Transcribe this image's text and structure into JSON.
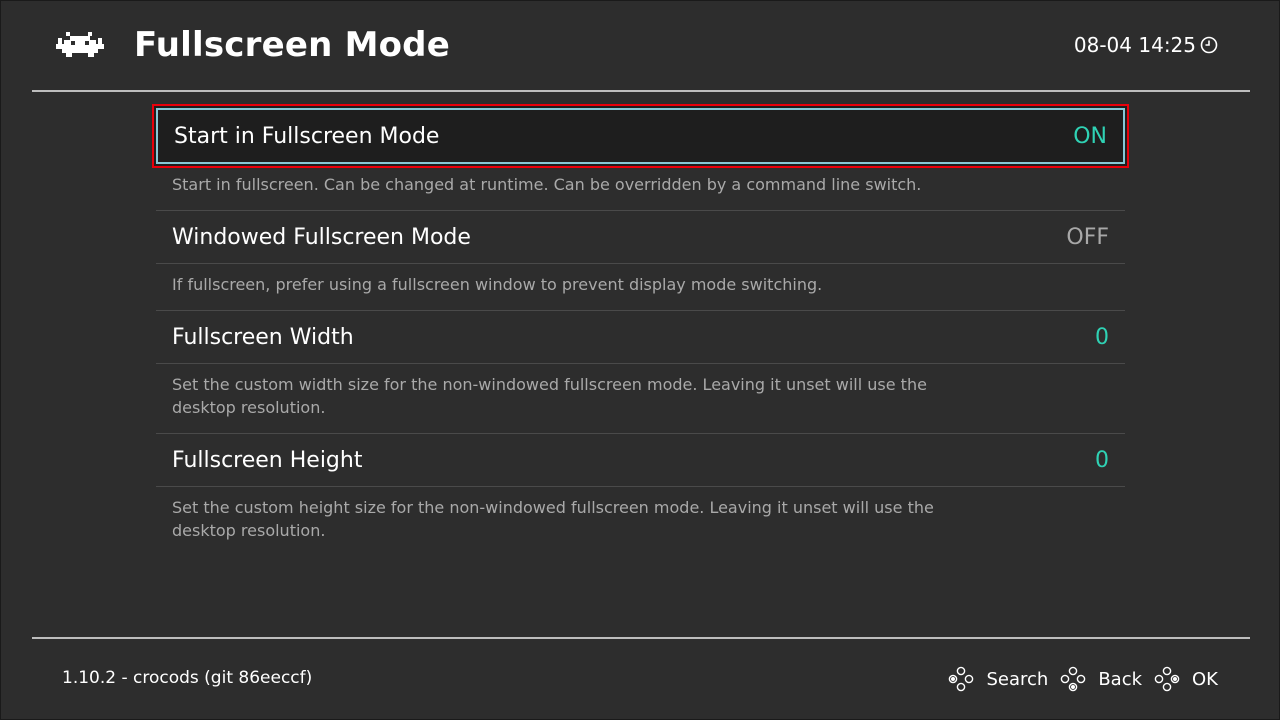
{
  "header": {
    "title": "Fullscreen Mode",
    "clock": "08-04 14:25",
    "logo_icon": "retroarch-invader-icon",
    "clock_icon": "clock-icon"
  },
  "settings": [
    {
      "label": "Start in Fullscreen Mode",
      "value": "ON",
      "description": "Start in fullscreen. Can be changed at runtime. Can be overridden by a command line switch.",
      "selected": true
    },
    {
      "label": "Windowed Fullscreen Mode",
      "value": "OFF",
      "description": "If fullscreen, prefer using a fullscreen window to prevent display mode switching.",
      "selected": false
    },
    {
      "label": "Fullscreen Width",
      "value": "0",
      "description": "Set the custom width size for the non-windowed fullscreen mode. Leaving it unset will use the desktop resolution.",
      "selected": false
    },
    {
      "label": "Fullscreen Height",
      "value": "0",
      "description": "Set the custom height size for the non-windowed fullscreen mode. Leaving it unset will use the desktop resolution.",
      "selected": false
    }
  ],
  "footer": {
    "version": "1.10.2 - crocods (git 86eeccf)",
    "hints": [
      {
        "label": "Search",
        "icon": "gamepad-buttons-icon"
      },
      {
        "label": "Back",
        "icon": "gamepad-buttons-icon"
      },
      {
        "label": "OK",
        "icon": "gamepad-buttons-icon"
      }
    ]
  },
  "colors": {
    "background": "#2d2d2d",
    "value_on": "#2fd2b4",
    "value_off": "#a8a8a8",
    "selection_border": "#87c8d6",
    "highlight_outline": "#e8000b"
  }
}
